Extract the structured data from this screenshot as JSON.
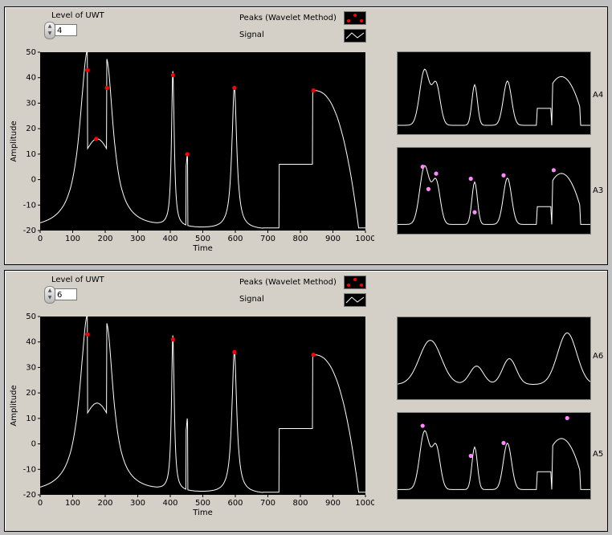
{
  "panels": [
    {
      "level_label": "Level of UWT",
      "level_value": "4",
      "legend": {
        "peaks_label": "Peaks (Wavelet Method)",
        "signal_label": "Signal"
      },
      "main_chart": {
        "type": "line",
        "xlabel": "Time",
        "ylabel": "Amplitude",
        "xlim": [
          0,
          1000
        ],
        "ylim": [
          -20,
          50
        ],
        "x_ticks": [
          "0",
          "100",
          "200",
          "300",
          "400",
          "500",
          "600",
          "700",
          "800",
          "900",
          "1000"
        ],
        "y_ticks": [
          "50",
          "40",
          "30",
          "20",
          "10",
          "0",
          "-10",
          "-20"
        ],
        "peaks": [
          [
            145,
            43
          ],
          [
            172,
            16
          ],
          [
            205,
            36
          ],
          [
            408,
            41
          ],
          [
            452,
            10
          ],
          [
            597,
            36
          ],
          [
            840,
            35
          ]
        ]
      },
      "sub_charts": [
        {
          "label": "A4",
          "peaks": []
        },
        {
          "label": "A3",
          "peaks": [
            [
              0.13,
              0.22
            ],
            [
              0.16,
              0.48
            ],
            [
              0.2,
              0.3
            ],
            [
              0.38,
              0.36
            ],
            [
              0.4,
              0.75
            ],
            [
              0.55,
              0.32
            ],
            [
              0.81,
              0.26
            ]
          ]
        }
      ]
    },
    {
      "level_label": "Level of UWT",
      "level_value": "6",
      "legend": {
        "peaks_label": "Peaks (Wavelet Method)",
        "signal_label": "Signal"
      },
      "main_chart": {
        "type": "line",
        "xlabel": "Time",
        "ylabel": "Amplitude",
        "xlim": [
          0,
          1000
        ],
        "ylim": [
          -20,
          50
        ],
        "x_ticks": [
          "0",
          "100",
          "200",
          "300",
          "400",
          "500",
          "600",
          "700",
          "800",
          "900",
          "1000"
        ],
        "y_ticks": [
          "50",
          "40",
          "30",
          "20",
          "10",
          "0",
          "-10",
          "-20"
        ],
        "peaks": [
          [
            145,
            43
          ],
          [
            408,
            41
          ],
          [
            597,
            36
          ],
          [
            840,
            35
          ]
        ]
      },
      "sub_charts": [
        {
          "label": "A6",
          "peaks": []
        },
        {
          "label": "A5",
          "peaks": [
            [
              0.13,
              0.15
            ],
            [
              0.38,
              0.5
            ],
            [
              0.55,
              0.35
            ],
            [
              0.88,
              0.06
            ]
          ]
        }
      ]
    }
  ],
  "colors": {
    "plot_bg": "#000000",
    "signal": "#ffffff",
    "peak_main": "#ff0000",
    "peak_sub": "#ff88ff"
  }
}
